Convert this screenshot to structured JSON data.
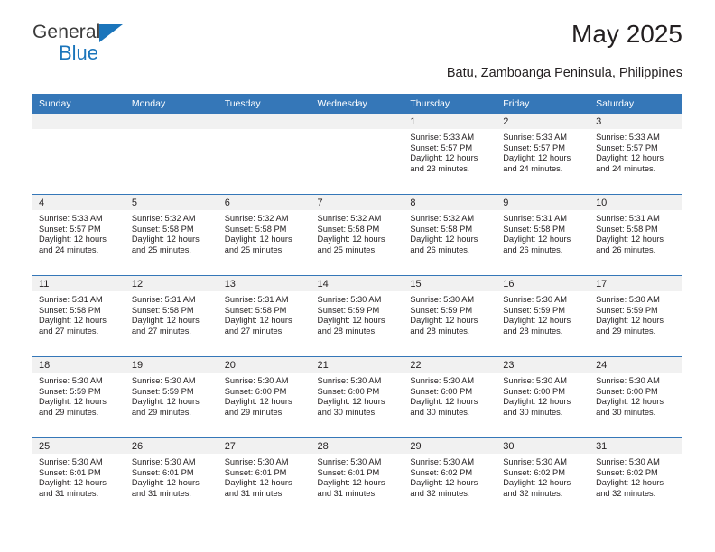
{
  "logo": {
    "word_one": "General",
    "word_two": "Blue",
    "triangle_color": "#1b75bb",
    "text_color": "#3b3b3b"
  },
  "header": {
    "title": "May 2025",
    "subtitle": "Batu, Zamboanga Peninsula, Philippines"
  },
  "theme": {
    "header_blue": "#3577b8",
    "daynum_band": "#f1f1f1",
    "text": "#231f20"
  },
  "calendar": {
    "weekday_headers": [
      "Sunday",
      "Monday",
      "Tuesday",
      "Wednesday",
      "Thursday",
      "Friday",
      "Saturday"
    ],
    "weeks": [
      [
        {
          "day": "",
          "sunrise": "",
          "sunset": "",
          "daylight_line1": "",
          "daylight_line2": ""
        },
        {
          "day": "",
          "sunrise": "",
          "sunset": "",
          "daylight_line1": "",
          "daylight_line2": ""
        },
        {
          "day": "",
          "sunrise": "",
          "sunset": "",
          "daylight_line1": "",
          "daylight_line2": ""
        },
        {
          "day": "",
          "sunrise": "",
          "sunset": "",
          "daylight_line1": "",
          "daylight_line2": ""
        },
        {
          "day": "1",
          "sunrise": "Sunrise: 5:33 AM",
          "sunset": "Sunset: 5:57 PM",
          "daylight_line1": "Daylight: 12 hours",
          "daylight_line2": "and 23 minutes."
        },
        {
          "day": "2",
          "sunrise": "Sunrise: 5:33 AM",
          "sunset": "Sunset: 5:57 PM",
          "daylight_line1": "Daylight: 12 hours",
          "daylight_line2": "and 24 minutes."
        },
        {
          "day": "3",
          "sunrise": "Sunrise: 5:33 AM",
          "sunset": "Sunset: 5:57 PM",
          "daylight_line1": "Daylight: 12 hours",
          "daylight_line2": "and 24 minutes."
        }
      ],
      [
        {
          "day": "4",
          "sunrise": "Sunrise: 5:33 AM",
          "sunset": "Sunset: 5:57 PM",
          "daylight_line1": "Daylight: 12 hours",
          "daylight_line2": "and 24 minutes."
        },
        {
          "day": "5",
          "sunrise": "Sunrise: 5:32 AM",
          "sunset": "Sunset: 5:58 PM",
          "daylight_line1": "Daylight: 12 hours",
          "daylight_line2": "and 25 minutes."
        },
        {
          "day": "6",
          "sunrise": "Sunrise: 5:32 AM",
          "sunset": "Sunset: 5:58 PM",
          "daylight_line1": "Daylight: 12 hours",
          "daylight_line2": "and 25 minutes."
        },
        {
          "day": "7",
          "sunrise": "Sunrise: 5:32 AM",
          "sunset": "Sunset: 5:58 PM",
          "daylight_line1": "Daylight: 12 hours",
          "daylight_line2": "and 25 minutes."
        },
        {
          "day": "8",
          "sunrise": "Sunrise: 5:32 AM",
          "sunset": "Sunset: 5:58 PM",
          "daylight_line1": "Daylight: 12 hours",
          "daylight_line2": "and 26 minutes."
        },
        {
          "day": "9",
          "sunrise": "Sunrise: 5:31 AM",
          "sunset": "Sunset: 5:58 PM",
          "daylight_line1": "Daylight: 12 hours",
          "daylight_line2": "and 26 minutes."
        },
        {
          "day": "10",
          "sunrise": "Sunrise: 5:31 AM",
          "sunset": "Sunset: 5:58 PM",
          "daylight_line1": "Daylight: 12 hours",
          "daylight_line2": "and 26 minutes."
        }
      ],
      [
        {
          "day": "11",
          "sunrise": "Sunrise: 5:31 AM",
          "sunset": "Sunset: 5:58 PM",
          "daylight_line1": "Daylight: 12 hours",
          "daylight_line2": "and 27 minutes."
        },
        {
          "day": "12",
          "sunrise": "Sunrise: 5:31 AM",
          "sunset": "Sunset: 5:58 PM",
          "daylight_line1": "Daylight: 12 hours",
          "daylight_line2": "and 27 minutes."
        },
        {
          "day": "13",
          "sunrise": "Sunrise: 5:31 AM",
          "sunset": "Sunset: 5:58 PM",
          "daylight_line1": "Daylight: 12 hours",
          "daylight_line2": "and 27 minutes."
        },
        {
          "day": "14",
          "sunrise": "Sunrise: 5:30 AM",
          "sunset": "Sunset: 5:59 PM",
          "daylight_line1": "Daylight: 12 hours",
          "daylight_line2": "and 28 minutes."
        },
        {
          "day": "15",
          "sunrise": "Sunrise: 5:30 AM",
          "sunset": "Sunset: 5:59 PM",
          "daylight_line1": "Daylight: 12 hours",
          "daylight_line2": "and 28 minutes."
        },
        {
          "day": "16",
          "sunrise": "Sunrise: 5:30 AM",
          "sunset": "Sunset: 5:59 PM",
          "daylight_line1": "Daylight: 12 hours",
          "daylight_line2": "and 28 minutes."
        },
        {
          "day": "17",
          "sunrise": "Sunrise: 5:30 AM",
          "sunset": "Sunset: 5:59 PM",
          "daylight_line1": "Daylight: 12 hours",
          "daylight_line2": "and 29 minutes."
        }
      ],
      [
        {
          "day": "18",
          "sunrise": "Sunrise: 5:30 AM",
          "sunset": "Sunset: 5:59 PM",
          "daylight_line1": "Daylight: 12 hours",
          "daylight_line2": "and 29 minutes."
        },
        {
          "day": "19",
          "sunrise": "Sunrise: 5:30 AM",
          "sunset": "Sunset: 5:59 PM",
          "daylight_line1": "Daylight: 12 hours",
          "daylight_line2": "and 29 minutes."
        },
        {
          "day": "20",
          "sunrise": "Sunrise: 5:30 AM",
          "sunset": "Sunset: 6:00 PM",
          "daylight_line1": "Daylight: 12 hours",
          "daylight_line2": "and 29 minutes."
        },
        {
          "day": "21",
          "sunrise": "Sunrise: 5:30 AM",
          "sunset": "Sunset: 6:00 PM",
          "daylight_line1": "Daylight: 12 hours",
          "daylight_line2": "and 30 minutes."
        },
        {
          "day": "22",
          "sunrise": "Sunrise: 5:30 AM",
          "sunset": "Sunset: 6:00 PM",
          "daylight_line1": "Daylight: 12 hours",
          "daylight_line2": "and 30 minutes."
        },
        {
          "day": "23",
          "sunrise": "Sunrise: 5:30 AM",
          "sunset": "Sunset: 6:00 PM",
          "daylight_line1": "Daylight: 12 hours",
          "daylight_line2": "and 30 minutes."
        },
        {
          "day": "24",
          "sunrise": "Sunrise: 5:30 AM",
          "sunset": "Sunset: 6:00 PM",
          "daylight_line1": "Daylight: 12 hours",
          "daylight_line2": "and 30 minutes."
        }
      ],
      [
        {
          "day": "25",
          "sunrise": "Sunrise: 5:30 AM",
          "sunset": "Sunset: 6:01 PM",
          "daylight_line1": "Daylight: 12 hours",
          "daylight_line2": "and 31 minutes."
        },
        {
          "day": "26",
          "sunrise": "Sunrise: 5:30 AM",
          "sunset": "Sunset: 6:01 PM",
          "daylight_line1": "Daylight: 12 hours",
          "daylight_line2": "and 31 minutes."
        },
        {
          "day": "27",
          "sunrise": "Sunrise: 5:30 AM",
          "sunset": "Sunset: 6:01 PM",
          "daylight_line1": "Daylight: 12 hours",
          "daylight_line2": "and 31 minutes."
        },
        {
          "day": "28",
          "sunrise": "Sunrise: 5:30 AM",
          "sunset": "Sunset: 6:01 PM",
          "daylight_line1": "Daylight: 12 hours",
          "daylight_line2": "and 31 minutes."
        },
        {
          "day": "29",
          "sunrise": "Sunrise: 5:30 AM",
          "sunset": "Sunset: 6:02 PM",
          "daylight_line1": "Daylight: 12 hours",
          "daylight_line2": "and 32 minutes."
        },
        {
          "day": "30",
          "sunrise": "Sunrise: 5:30 AM",
          "sunset": "Sunset: 6:02 PM",
          "daylight_line1": "Daylight: 12 hours",
          "daylight_line2": "and 32 minutes."
        },
        {
          "day": "31",
          "sunrise": "Sunrise: 5:30 AM",
          "sunset": "Sunset: 6:02 PM",
          "daylight_line1": "Daylight: 12 hours",
          "daylight_line2": "and 32 minutes."
        }
      ]
    ]
  }
}
